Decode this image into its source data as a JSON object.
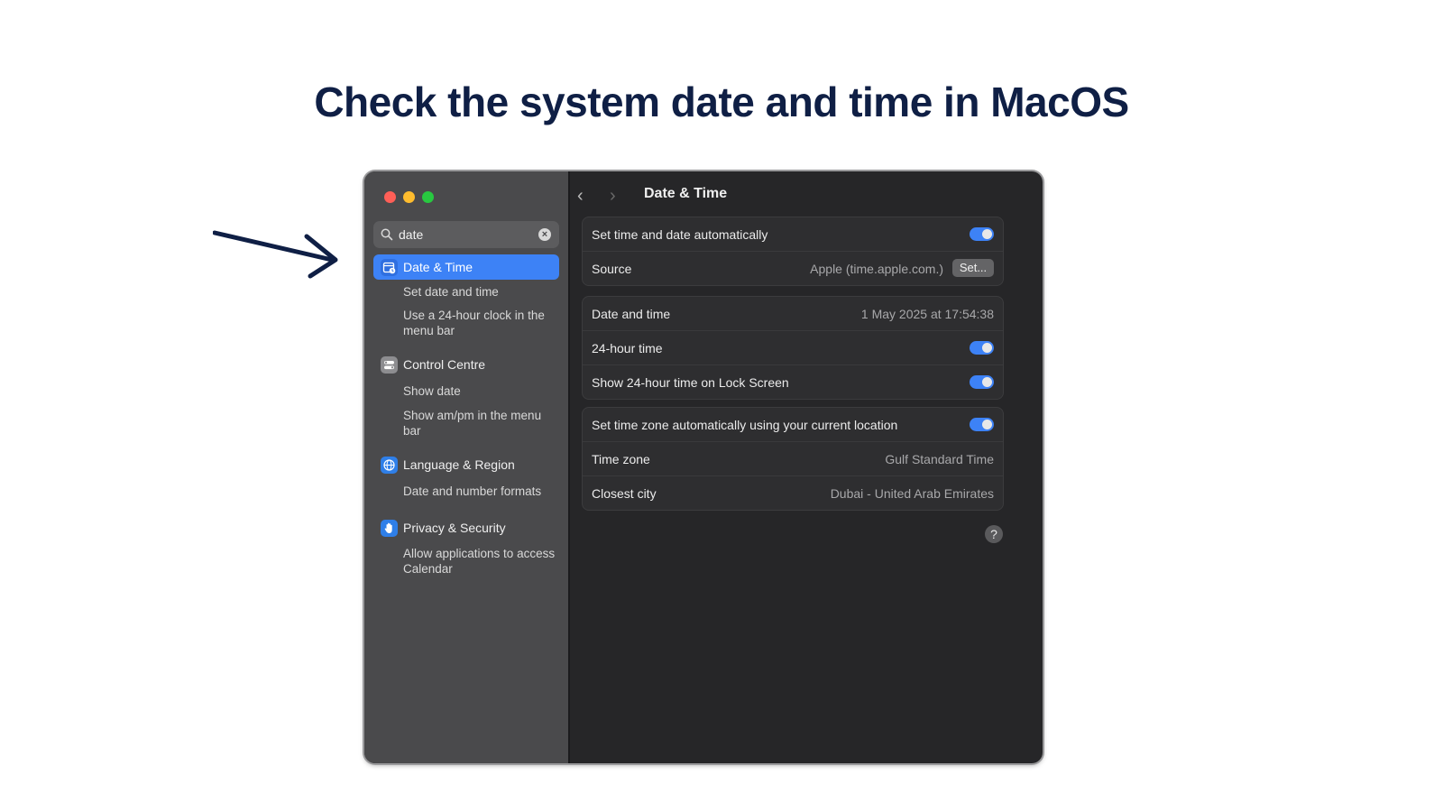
{
  "heading": "Check the system date and time in MacOS",
  "search": {
    "value": "date",
    "clear_icon": "x-circle-icon"
  },
  "sidebar": {
    "items": [
      {
        "label": "Date & Time",
        "icon": "calendar-clock-icon",
        "icon_color": "#2f6fe0",
        "active": true
      },
      {
        "label": "Control Centre",
        "icon": "control-centre-icon",
        "icon_color": "#8d8d90"
      },
      {
        "label": "Language & Region",
        "icon": "globe-icon",
        "icon_color": "#2f7fe8"
      },
      {
        "label": "Privacy & Security",
        "icon": "hand-icon",
        "icon_color": "#2f7fe8"
      }
    ],
    "subitems": [
      "Set date and time",
      "Use a 24-hour clock in the menu bar",
      "Show date",
      "Show am/pm in the menu bar",
      "Date and number formats",
      "Allow applications to access Calendar"
    ]
  },
  "main": {
    "title": "Date & Time",
    "group1": {
      "auto_label": "Set time and date automatically",
      "auto_on": true,
      "source_label": "Source",
      "source_value": "Apple (time.apple.com.)",
      "set_button": "Set..."
    },
    "group2": {
      "datetime_label": "Date and time",
      "datetime_value": "1 May 2025 at 17:54:38",
      "h24_label": "24-hour time",
      "lock_label": "Show 24-hour time on Lock Screen"
    },
    "group3": {
      "tz_auto_label": "Set time zone automatically using your current location",
      "tz_label": "Time zone",
      "tz_value": "Gulf Standard Time",
      "city_label": "Closest city",
      "city_value": "Dubai - United Arab Emirates"
    },
    "help": "?"
  },
  "colors": {
    "accent": "#3d82f6",
    "heading": "#0f1f45",
    "sidebar_bg": "#4a4a4c",
    "main_bg": "#262628"
  }
}
